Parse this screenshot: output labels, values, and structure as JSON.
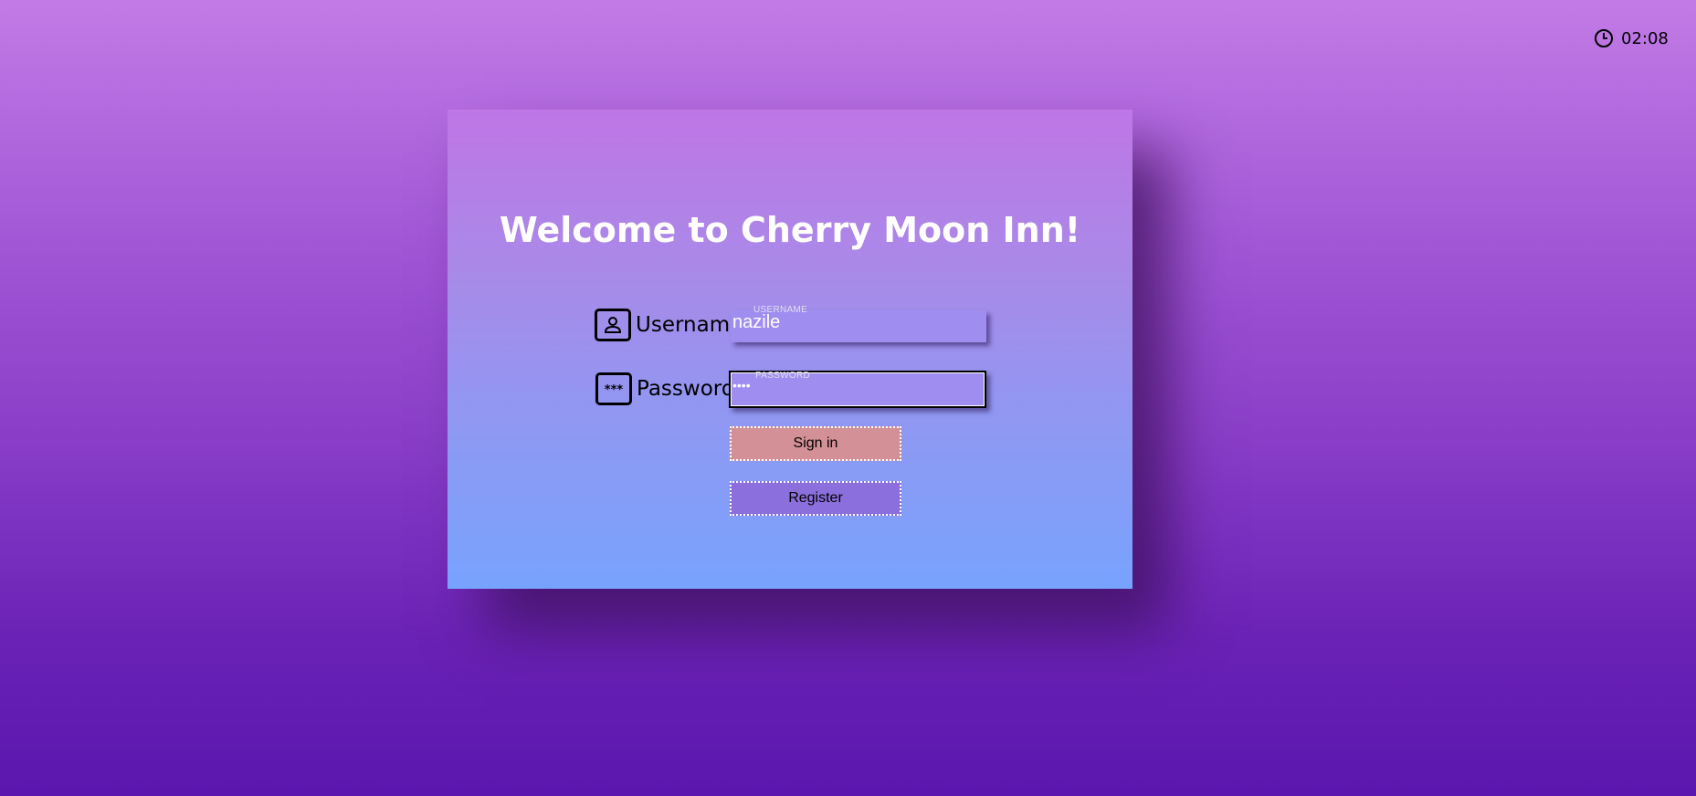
{
  "clock": {
    "icon": "clock-icon",
    "time": "02:08"
  },
  "card": {
    "title": "Welcome to Cherry Moon Inn!"
  },
  "form": {
    "username": {
      "icon": "user-icon",
      "label": "Username",
      "floating_label": "USERNAME",
      "value": "nazile"
    },
    "password": {
      "icon": "password-icon",
      "icon_glyph": "***",
      "label": "Password",
      "floating_label": "PASSWORD",
      "value": "••••"
    },
    "sign_in_label": "Sign in",
    "register_label": "Register"
  },
  "colors": {
    "sign_in_button": "#d39096",
    "register_button": "#8b6fdc",
    "field_background": "#9f8ef0"
  }
}
